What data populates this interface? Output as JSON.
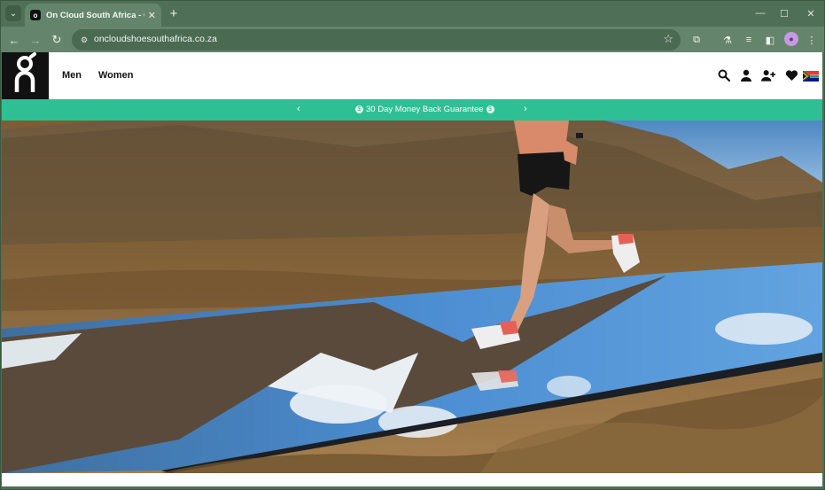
{
  "browser": {
    "tab": {
      "title": "On Cloud South Africa - On Ru",
      "favicon": "on-logo-icon"
    },
    "address": {
      "url": "oncloudshoesouthafrica.co.za"
    }
  },
  "site": {
    "nav": {
      "men": "Men",
      "women": "Women"
    },
    "promo": {
      "text": "30 Day Money Back Guarantee",
      "prev": "‹",
      "next": "›"
    }
  },
  "colors": {
    "accent": "#2fbf95",
    "browser_frame": "#4f6f57",
    "browser_toolbar": "#64856b"
  }
}
